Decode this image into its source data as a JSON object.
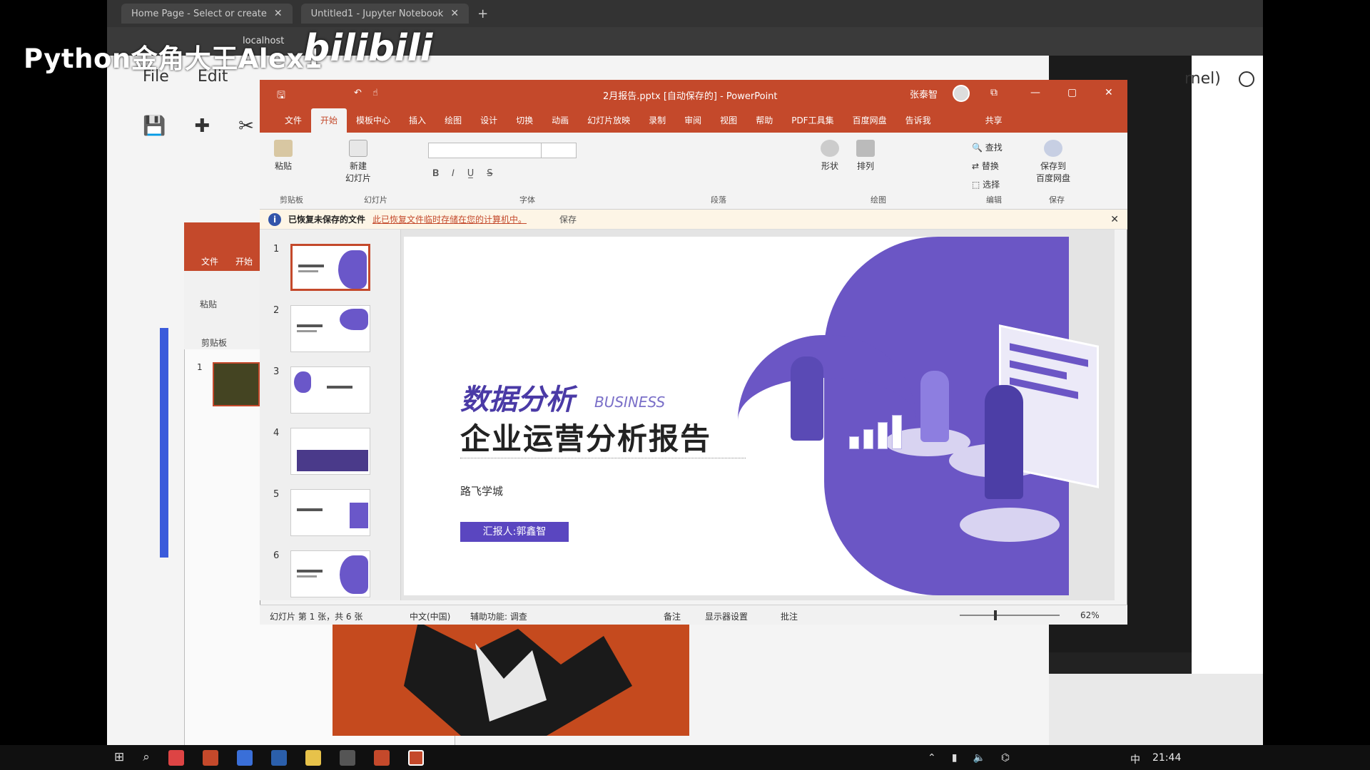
{
  "browser": {
    "tabs": [
      {
        "label": "Home Page - Select or create"
      },
      {
        "label": "Untitled1 - Jupyter Notebook"
      }
    ],
    "address": "localhost"
  },
  "jupyter": {
    "menu": [
      "File",
      "Edit"
    ],
    "kernel_label": "rnel)"
  },
  "watermark": {
    "text": "Python金角大王Alex1",
    "logo": "bilibili"
  },
  "ppt_small": {
    "tabs": [
      "文件",
      "开始"
    ],
    "ribbon_labels": [
      "粘贴",
      "剪贴板"
    ],
    "thumb_num": "1"
  },
  "ppt": {
    "title": "2月报告.pptx [自动保存的]  -  PowerPoint",
    "user": "张泰智",
    "tabs": [
      "文件",
      "开始",
      "模板中心",
      "插入",
      "绘图",
      "设计",
      "切换",
      "动画",
      "幻灯片放映",
      "录制",
      "审阅",
      "视图",
      "帮助",
      "PDF工具集",
      "百度网盘",
      "告诉我",
      "共享"
    ],
    "active_tab_index": 1,
    "ribbon": {
      "paste": "粘贴",
      "new_slide_line1": "新建",
      "new_slide_line2": "幻灯片",
      "shapes": "形状",
      "arrange": "排列",
      "find": "查找",
      "replace": "替换",
      "select": "选择",
      "save_to_line1": "保存到",
      "save_to_line2": "百度网盘",
      "groups": [
        "剪贴板",
        "幻灯片",
        "字体",
        "段落",
        "绘图",
        "编辑",
        "保存"
      ]
    },
    "infobar": {
      "bold": "已恢复未保存的文件",
      "link": "此已恢复文件临时存储在您的计算机中。",
      "save": "保存"
    },
    "thumbnails": [
      "1",
      "2",
      "3",
      "4",
      "5",
      "6"
    ],
    "selected_slide": 1,
    "slide": {
      "title1": "数据分析",
      "title1_en": "BUSINESS",
      "title2": "企业运营分析报告",
      "org": "路飞学城",
      "presenter_button": "汇报人:郭鑫智"
    },
    "statusbar": {
      "slide_info": "幻灯片 第 1 张，共 6 张",
      "language": "中文(中国)",
      "accessibility": "辅助功能: 调查",
      "notes": "备注",
      "display": "显示器设置",
      "comments": "批注",
      "zoom": "62%"
    }
  },
  "taskbar": {
    "lang": "中",
    "time": "21:44"
  },
  "colors": {
    "ppt_accent": "#c4492b",
    "slide_purple": "#6b56c5"
  }
}
